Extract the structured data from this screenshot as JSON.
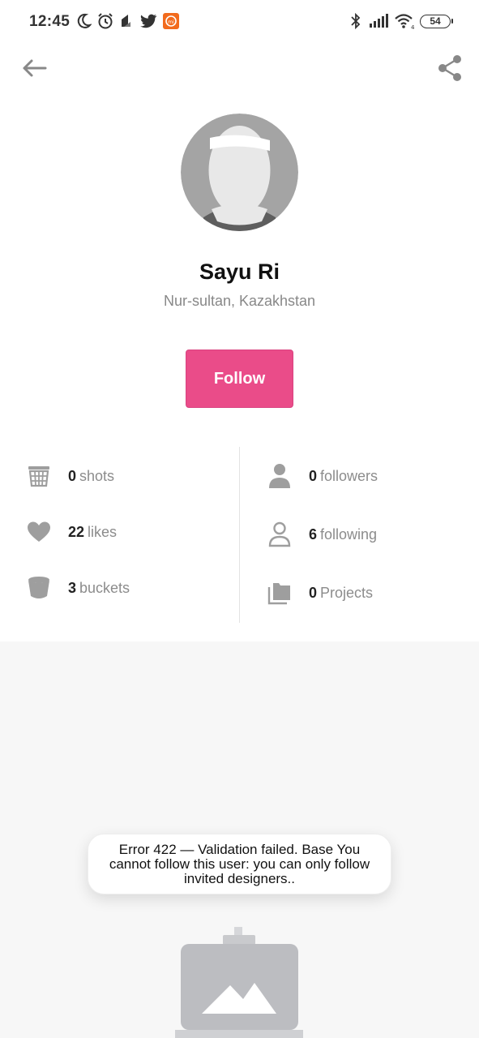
{
  "status_bar": {
    "time": "12:45",
    "battery": "54",
    "icons": [
      "moon-icon",
      "alarm-icon",
      "notification-app-icon",
      "twitter-icon",
      "mi-app-icon",
      "bluetooth-icon",
      "signal-icon",
      "wifi-icon",
      "battery-icon"
    ]
  },
  "nav": {
    "back_icon": "arrow-left-icon",
    "share_icon": "share-icon"
  },
  "profile": {
    "name": "Sayu Ri",
    "location": "Nur-sultan, Kazakhstan",
    "follow_label": "Follow"
  },
  "stats": {
    "left": [
      {
        "count": "0",
        "label": "shots",
        "icon": "shots-basket-icon"
      },
      {
        "count": "22",
        "label": "likes",
        "icon": "heart-icon"
      },
      {
        "count": "3",
        "label": "buckets",
        "icon": "bucket-icon"
      }
    ],
    "right": [
      {
        "count": "0",
        "label": "followers",
        "icon": "person-filled-icon"
      },
      {
        "count": "6",
        "label": "following",
        "icon": "person-outline-icon"
      },
      {
        "count": "0",
        "label": "Projects",
        "icon": "folders-icon"
      }
    ]
  },
  "toast": {
    "message": "Error 422 — Validation failed. Base You cannot follow this user: you can only follow invited designers.."
  },
  "colors": {
    "accent": "#ea4c89",
    "icon_gray": "#9e9e9e",
    "lower_background": "#f7f7f7"
  }
}
